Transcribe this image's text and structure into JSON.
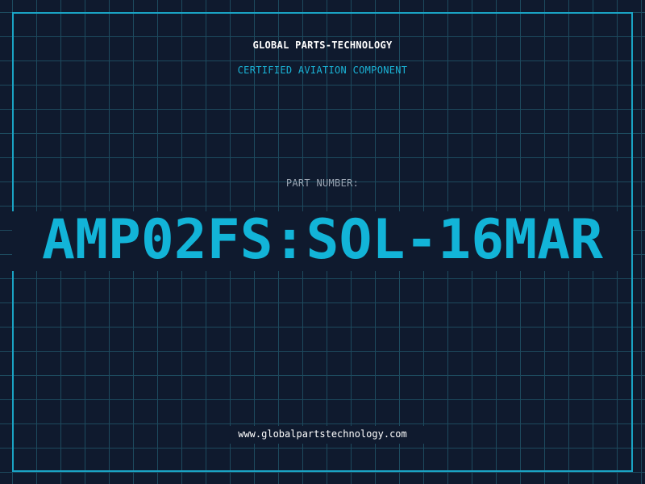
{
  "label": {
    "company": "GLOBAL PARTS-TECHNOLOGY",
    "subtitle": "CERTIFIED AVIATION COMPONENT",
    "part_number_label": "PART NUMBER:",
    "part_number": "AMP02FS:SOL-16MAR",
    "website": "www.globalpartstechnology.com"
  },
  "colors": {
    "background": "#0f1a2e",
    "grid": "#1d4a5e",
    "frame": "#1aa3c4",
    "accent": "#12b4d8",
    "muted": "#9aa4b2",
    "text": "#ffffff"
  }
}
